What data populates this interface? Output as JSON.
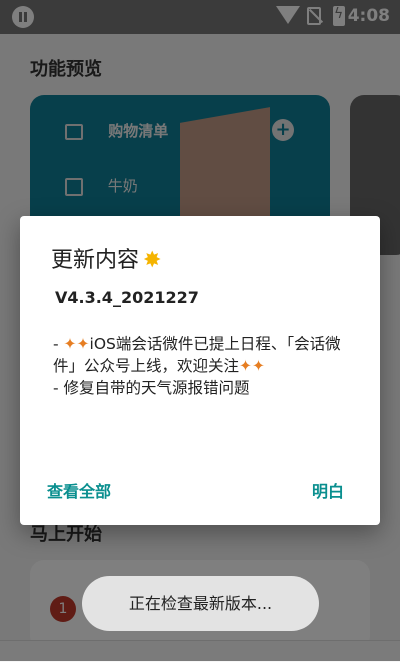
{
  "status_bar": {
    "time": "4:08"
  },
  "background": {
    "section_preview_title": "功能预览",
    "preview_card": {
      "title": "购物清单",
      "item": "牛奶"
    },
    "section_start_title": "马上开始",
    "step_number": "1"
  },
  "dialog": {
    "title": "更新内容",
    "version": "V4.3.4_2021227",
    "line1_prefix": "- ",
    "line1_text": "iOS端会话微件已提上日程、「会话微件」公众号上线，欢迎关注",
    "line2": "- 修复自带的天气源报错问题",
    "btn_view_all": "查看全部",
    "btn_ok": "明白"
  },
  "toast": {
    "text": "正在检查最新版本..."
  },
  "colors": {
    "accent": "#0a8f8f",
    "card": "#0e7f96",
    "scrim": "rgba(0,0,0,0.5)"
  }
}
